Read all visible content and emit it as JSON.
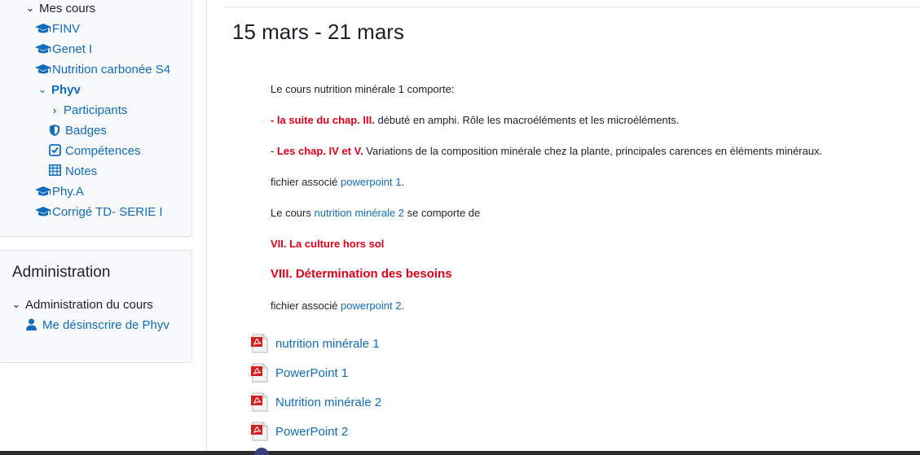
{
  "nav": {
    "mes_cours": "Mes cours",
    "courses": [
      "FINV",
      "Genet I",
      "Nutrition carbonée S4",
      "Phyv",
      "Phy.A",
      "Corrigé TD- SERIE I"
    ],
    "phyv_children": [
      "Participants",
      "Badges",
      "Compétences",
      "Notes"
    ]
  },
  "admin": {
    "title": "Administration",
    "course_admin": "Administration du cours",
    "unenrol": "Me désinscrire de Phyv"
  },
  "section": {
    "title": "15 mars - 21 mars",
    "p1": "Le cours nutrition minérale 1 comporte:",
    "p2_red": "- la suite du chap. III.",
    "p2_rest": " débuté en amphi.   Rôle  les macroéléments et les microéléments.",
    "p3_dash": "- ",
    "p3_red": "Les chap. IV et V.",
    "p3_rest": " Variations de la composition minérale  chez la plante, principales carences en éléments minéraux.",
    "p4_prefix": "fichier associé ",
    "p4_link": "powerpoint 1",
    "p4_suffix": ".",
    "p5_prefix": "Le cours ",
    "p5_link": "nutrition minérale 2",
    "p5_suffix": "  se comporte de",
    "p6_red": "VII. La culture hors sol",
    "p7_red": "VIII. Détermination des besoins",
    "p8_prefix": " fichier associé ",
    "p8_link": "powerpoint 2",
    "p8_suffix": "."
  },
  "resources": [
    "nutrition minérale 1",
    "PowerPoint 1",
    "Nutrition minérale 2",
    "PowerPoint 2"
  ],
  "colors": {
    "link": "#0f6cbf",
    "red": "#e0001a",
    "text": "#1d2125"
  },
  "icons": {
    "course": "graduation-cap-icon",
    "resource": "pdf-icon"
  }
}
